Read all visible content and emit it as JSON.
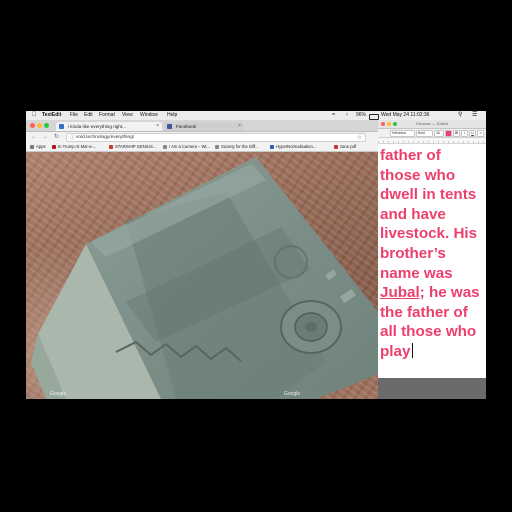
{
  "menubar": {
    "app_name": "TextEdit",
    "items": [
      "File",
      "Edit",
      "Format",
      "View",
      "Window",
      "Help"
    ],
    "battery": "96%",
    "clock": "Wed May 24  11:02:36"
  },
  "browser": {
    "tabs": [
      {
        "label": "i kinda like everything right...",
        "active": true,
        "favicon_color": "#3a6cc9"
      },
      {
        "label": "Facebook",
        "active": false,
        "favicon_color": "#3b5998"
      }
    ],
    "url": "void.technology/everything/",
    "bookmarks": [
      {
        "label": "Apps",
        "color": "#777777"
      },
      {
        "label": "In Trump At Mar-a-...",
        "color": "#b0131f"
      },
      {
        "label": "STARSHIP GENIUS...",
        "color": "#c73b2b"
      },
      {
        "label": "I Am a Camera – Wi...",
        "color": "#888888"
      },
      {
        "label": "Society for the Diff...",
        "color": "#888888"
      },
      {
        "label": "HyperNormalisation...",
        "color": "#2a5fb8"
      },
      {
        "label": "zane.pdf",
        "color": "#cc3333"
      }
    ],
    "map_watermarks": [
      "Google",
      "Google"
    ]
  },
  "editor": {
    "title": "Genesis — Edited",
    "font_family_select": "Helvetica",
    "font_style_select": "Bold",
    "font_size_select": "36",
    "text_color": "#ec3f6c",
    "lines": [
      {
        "text": "father of"
      },
      {
        "text": "those who"
      },
      {
        "text": "dwell in tents"
      },
      {
        "text": "and have"
      },
      {
        "text": "livestock. His"
      },
      {
        "text": "brother’s"
      },
      {
        "text": "name was"
      },
      {
        "text_underlined": "Jubal",
        "text_rest": "; he was"
      },
      {
        "text": "the father of"
      },
      {
        "text": "all those who"
      },
      {
        "text": "play"
      }
    ]
  }
}
